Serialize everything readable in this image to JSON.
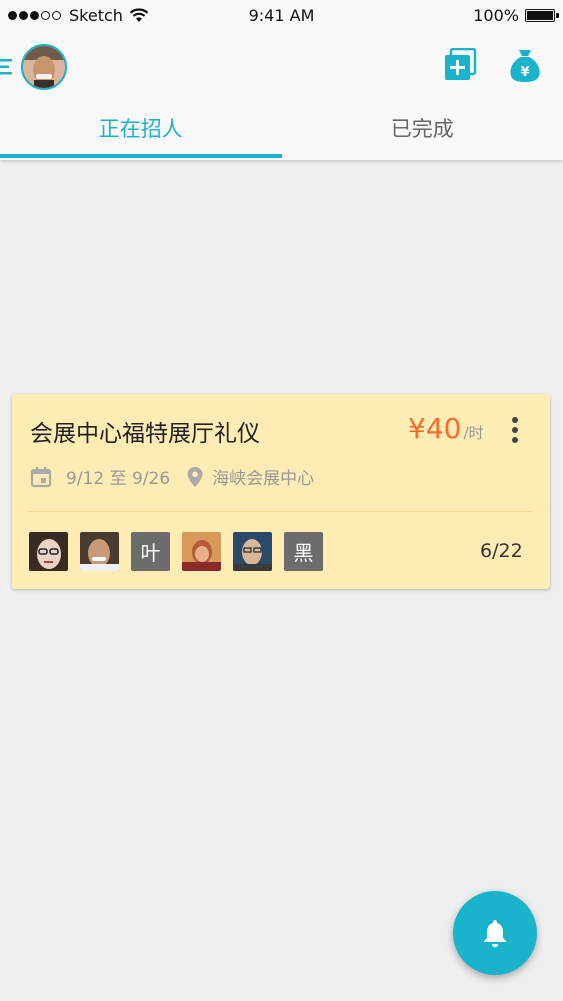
{
  "status_bar": {
    "carrier": "Sketch",
    "time": "9:41 AM",
    "battery": "100%"
  },
  "header": {
    "icons": [
      "menu-icon",
      "avatar",
      "add-post-icon",
      "money-bag-icon"
    ],
    "money_symbol": "¥"
  },
  "tabs": [
    {
      "label": "正在招人",
      "active": true
    },
    {
      "label": "已完成",
      "active": false
    }
  ],
  "card": {
    "title": "会展中心福特展厅礼仪",
    "price": "¥40",
    "price_unit": "/时",
    "date_range": "9/12 至 9/26",
    "location": "海峡会展中心",
    "members": [
      {
        "type": "photo",
        "icon": "member-photo-1"
      },
      {
        "type": "photo",
        "icon": "member-photo-2"
      },
      {
        "type": "text",
        "text": "叶"
      },
      {
        "type": "photo",
        "icon": "member-photo-3"
      },
      {
        "type": "photo",
        "icon": "member-photo-4"
      },
      {
        "type": "text",
        "text": "黑"
      }
    ],
    "count": "6/22"
  },
  "fab": {
    "icon": "bell-icon"
  },
  "colors": {
    "accent": "#1ab3cc",
    "card_bg": "#fdedb5",
    "price": "#f46b2a",
    "background": "#efefef"
  }
}
